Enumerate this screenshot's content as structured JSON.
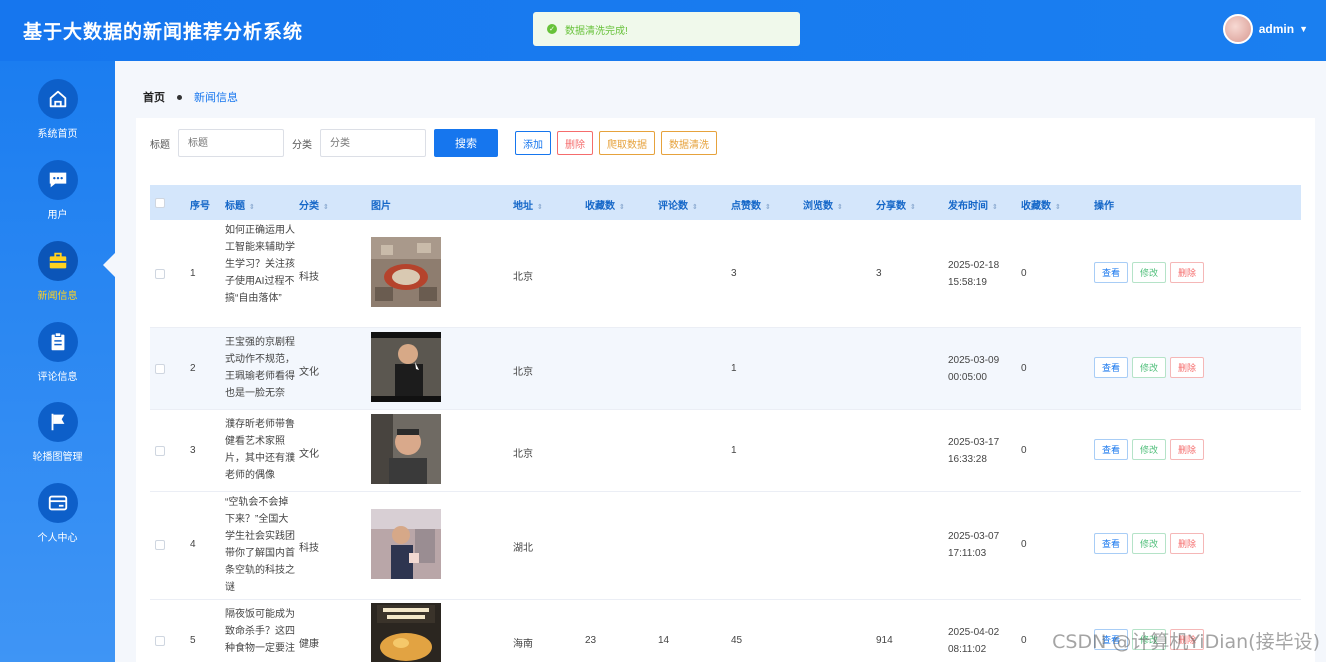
{
  "header": {
    "title": "基于大数据的新闻推荐分析系统",
    "username": "admin"
  },
  "toast": {
    "message": "数据清洗完成!"
  },
  "sidebar": {
    "items": [
      {
        "label": "系统首页",
        "icon": "home-icon"
      },
      {
        "label": "用户",
        "icon": "chat-icon"
      },
      {
        "label": "新闻信息",
        "icon": "briefcase-icon",
        "active": true
      },
      {
        "label": "评论信息",
        "icon": "clipboard-icon"
      },
      {
        "label": "轮播图管理",
        "icon": "flag-icon"
      },
      {
        "label": "个人中心",
        "icon": "wallet-icon"
      }
    ]
  },
  "breadcrumb": {
    "home": "首页",
    "current": "新闻信息"
  },
  "search": {
    "title_label": "标题",
    "title_placeholder": "标题",
    "category_label": "分类",
    "category_placeholder": "分类",
    "search_button": "搜索",
    "add_button": "添加",
    "delete_button": "删除",
    "crawl_button": "爬取数据",
    "clean_button": "数据清洗"
  },
  "table": {
    "headers": [
      "序号",
      "标题",
      "分类",
      "图片",
      "地址",
      "收藏数",
      "评论数",
      "点赞数",
      "浏览数",
      "分享数",
      "发布时间",
      "收藏数",
      "操作"
    ],
    "actions": {
      "view": "查看",
      "edit": "修改",
      "delete": "删除"
    },
    "rows": [
      {
        "index": "1",
        "title": "如何正确运用人工智能来辅助学生学习？关注孩子使用AI过程不搞“自由落体”",
        "category": "科技",
        "address": "北京",
        "favorites": "",
        "comments": "",
        "likes": "3",
        "views": "",
        "shares": "3",
        "time": "2025-02-18 15:58:19",
        "collect": "0"
      },
      {
        "index": "2",
        "title": "王宝强的京剧程式动作不规范，王珮瑜老师看得也是一脸无奈",
        "category": "文化",
        "address": "北京",
        "favorites": "",
        "comments": "",
        "likes": "1",
        "views": "",
        "shares": "",
        "time": "2025-03-09 00:05:00",
        "collect": "0"
      },
      {
        "index": "3",
        "title": "濮存昕老师带鲁健看艺术家照片，其中还有濮老师的偶像",
        "category": "文化",
        "address": "北京",
        "favorites": "",
        "comments": "",
        "likes": "1",
        "views": "",
        "shares": "",
        "time": "2025-03-17 16:33:28",
        "collect": "0"
      },
      {
        "index": "4",
        "title": "“空轨会不会掉下来？”全国大学生社会实践团带你了解国内首条空轨的科技之谜",
        "category": "科技",
        "address": "湖北",
        "favorites": "",
        "comments": "",
        "likes": "",
        "views": "",
        "shares": "",
        "time": "2025-03-07 17:11:03",
        "collect": "0"
      },
      {
        "index": "5",
        "title": "隔夜饭可能成为致命杀手？这四种食物一定要注",
        "category": "健康",
        "address": "海南",
        "favorites": "23",
        "comments": "14",
        "likes": "45",
        "views": "",
        "shares": "914",
        "time": "2025-04-02 08:11:02",
        "collect": "0"
      }
    ]
  },
  "watermark": "CSDN @计算机YiDian(接毕设)"
}
